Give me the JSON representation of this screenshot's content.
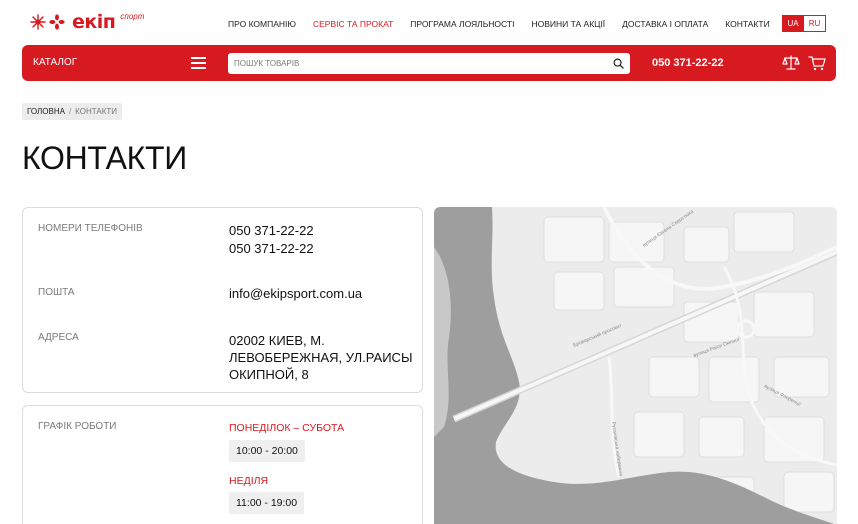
{
  "header": {
    "logo_text": "екіп",
    "logo_sub": "спорт",
    "nav": [
      {
        "label": "ПРО КОМПАНІЮ"
      },
      {
        "label": "СЕРВІС ТА ПРОКАТ"
      },
      {
        "label": "ПРОГРАМА ЛОЯЛЬНОСТІ"
      },
      {
        "label": "НОВИНИ ТА АКЦІЇ"
      },
      {
        "label": "ДОСТАВКА І ОПЛАТА"
      },
      {
        "label": "КОНТАКТИ"
      }
    ],
    "lang": {
      "ua": "UA",
      "ru": "RU"
    }
  },
  "toolbar": {
    "catalog": "КАТАЛОГ",
    "search_placeholder": "ПОШУК ТОВАРІВ",
    "phone": "050 371-22-22"
  },
  "breadcrumb": {
    "home": "ГОЛОВНА",
    "sep": "/",
    "current": "КОНТАКТИ"
  },
  "page": {
    "title": "КОНТАКТИ"
  },
  "contacts": {
    "phones_label": "НОМЕРИ ТЕЛЕФОНІВ",
    "phone1": "050 371-22-22",
    "phone2": "050 371-22-22",
    "email_label": "ПОШТА",
    "email": "info@ekipsport.com.ua",
    "address_label": "АДРЕСА",
    "address": "02002 КИЕВ, М. ЛЕВОБЕРЕЖНАЯ, УЛ.РАИСЫ ОКИПНОЙ, 8"
  },
  "schedule": {
    "label": "ГРАФІК РОБОТИ",
    "weekday_label": "ПОНЕДІЛОК – СУБОТА",
    "weekday_hours": "10:00 - 20:00",
    "sunday_label": "НЕДІЛЯ",
    "sunday_hours": "11:00 - 19:00"
  },
  "map": {
    "labels": [
      "Бровар­ський проспект",
      "вулиця Раїси Окіпної",
      "Русанівська набережна",
      "вулиця Флоренції",
      "вулиця Євгена Сверстюка"
    ]
  },
  "colors": {
    "brand": "#d71920",
    "map_bg": "#ececec",
    "water": "#9e9e9e"
  },
  "icons": {
    "search": "search-icon",
    "menu": "menu-icon",
    "compare": "scales-icon",
    "cart": "cart-icon"
  }
}
